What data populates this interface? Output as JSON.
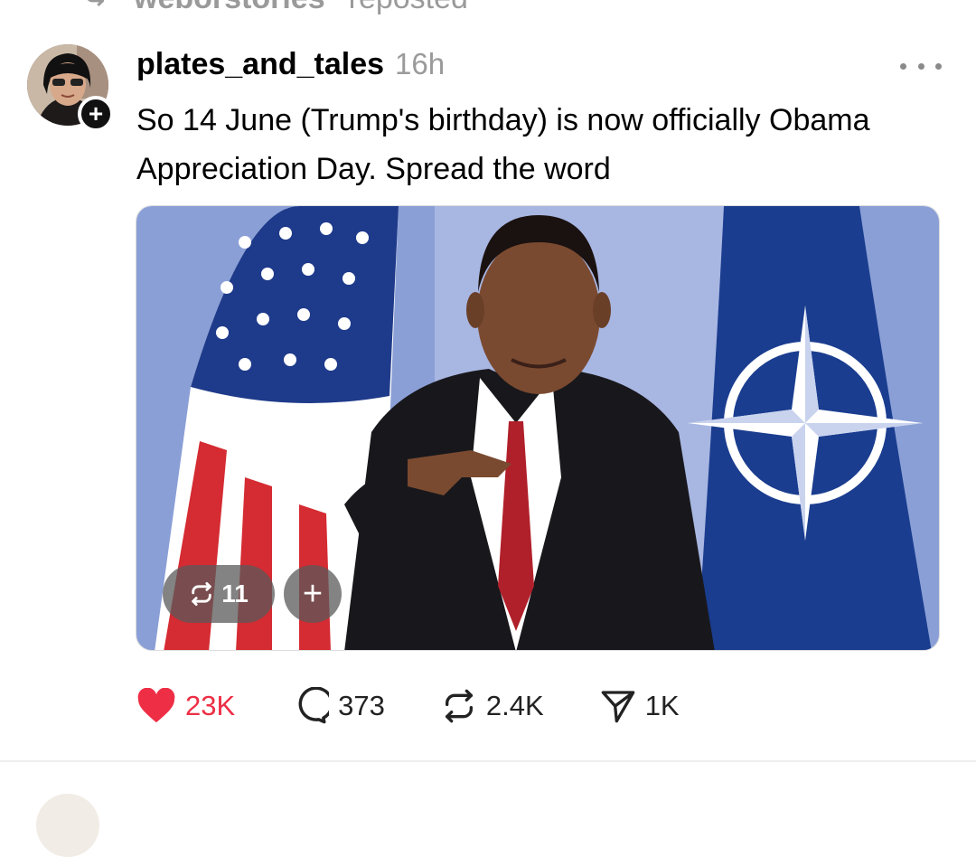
{
  "repost_header": {
    "user": "weborstories",
    "label": "reposted"
  },
  "post": {
    "username": "plates_and_tales",
    "time": "16h",
    "text": "So 14 June (Trump's birthday) is now officially Obama Appreciation Day. Spread the word",
    "image_overlay": {
      "repost_count": "11",
      "add_symbol": "+"
    }
  },
  "actions": {
    "likes": "23K",
    "replies": "373",
    "reposts": "2.4K",
    "shares": "1K"
  },
  "colors": {
    "like": "#ee2e45",
    "muted": "#9a9a9a"
  },
  "icons": [
    "repost-icon",
    "plus-icon",
    "more-icon",
    "heart-icon",
    "comment-icon",
    "share-icon"
  ]
}
